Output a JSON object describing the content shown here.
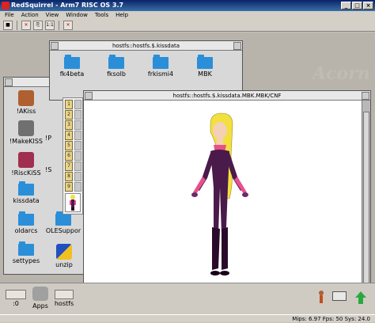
{
  "app": {
    "title": "RedSquirrel - Arm7 RISC OS 3.7",
    "menu": [
      "File",
      "Action",
      "View",
      "Window",
      "Tools",
      "Help"
    ],
    "toolbar_buttons": [
      "save-icon",
      "stop-icon",
      "reset-icon",
      "ratio-icon",
      "settings-icon"
    ],
    "window_buttons": [
      "_",
      "□",
      "×"
    ]
  },
  "kissdata_window": {
    "title": "hostfs::hostfs.$.kissdata",
    "items": [
      "fk4beta",
      "fksolb",
      "frkismi4",
      "MBK"
    ]
  },
  "root_window": {
    "items": [
      "!AKiss",
      "!MakeKISS",
      "!RiscKiSS",
      "kissdata",
      "oldarcs",
      "settypes",
      "!P",
      "!S",
      "OLESuppor",
      "unzip"
    ]
  },
  "viewer_window": {
    "title": "hostfs::hostfs.$.kissdata.MBK.MBK/CNF"
  },
  "kiss_cells": [
    "1",
    "2",
    "3",
    "4",
    "5",
    "6",
    "7",
    "8",
    "9"
  ],
  "iconbar": {
    "drive_label": ":0",
    "apps_label": "Apps",
    "hostfs_label": "hostfs"
  },
  "status": {
    "text": "Mips: 6.97  Fps: 50  Sys: 24.0"
  },
  "colors": {
    "bodysuit": "#4a1a4a",
    "hair": "#f2e040",
    "accent_pink": "#e8508c",
    "folder_blue": "#2a8fd8",
    "titlebar": "#0a246a"
  }
}
